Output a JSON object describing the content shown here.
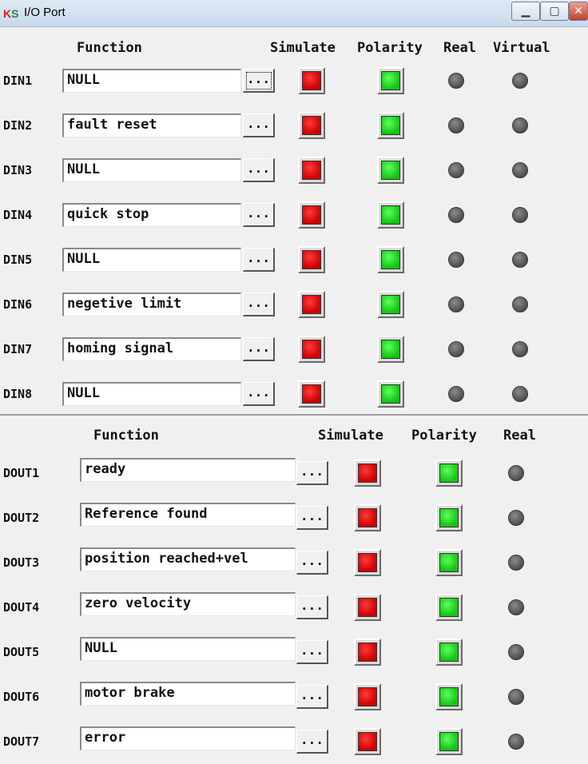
{
  "window": {
    "title": "I/O Port",
    "icon": "ks-app-icon",
    "icon_text_k": "K",
    "icon_text_s": "S",
    "min_glyph": "▁",
    "max_glyph": "▢",
    "close_glyph": "✕"
  },
  "din": {
    "headers": {
      "function": "Function",
      "simulate": "Simulate",
      "polarity": "Polarity",
      "real": "Real",
      "virtual": "Virtual"
    },
    "rows": [
      {
        "label": "DIN1",
        "function": "NULL",
        "button": "...",
        "simulate": "red",
        "polarity": "green",
        "real": "off",
        "virtual": "off"
      },
      {
        "label": "DIN2",
        "function": "fault reset",
        "button": "...",
        "simulate": "red",
        "polarity": "green",
        "real": "off",
        "virtual": "off"
      },
      {
        "label": "DIN3",
        "function": "NULL",
        "button": "...",
        "simulate": "red",
        "polarity": "green",
        "real": "off",
        "virtual": "off"
      },
      {
        "label": "DIN4",
        "function": "quick stop",
        "button": "...",
        "simulate": "red",
        "polarity": "green",
        "real": "off",
        "virtual": "off"
      },
      {
        "label": "DIN5",
        "function": "NULL",
        "button": "...",
        "simulate": "red",
        "polarity": "green",
        "real": "off",
        "virtual": "off"
      },
      {
        "label": "DIN6",
        "function": "negetive limit",
        "button": "...",
        "simulate": "red",
        "polarity": "green",
        "real": "off",
        "virtual": "off"
      },
      {
        "label": "DIN7",
        "function": "homing signal",
        "button": "...",
        "simulate": "red",
        "polarity": "green",
        "real": "off",
        "virtual": "off"
      },
      {
        "label": "DIN8",
        "function": "NULL",
        "button": "...",
        "simulate": "red",
        "polarity": "green",
        "real": "off",
        "virtual": "off"
      }
    ]
  },
  "dout": {
    "headers": {
      "function": "Function",
      "simulate": "Simulate",
      "polarity": "Polarity",
      "real": "Real"
    },
    "rows": [
      {
        "label": "DOUT1",
        "function": "ready",
        "button": "...",
        "simulate": "red",
        "polarity": "green",
        "real": "off"
      },
      {
        "label": "DOUT2",
        "function": "Reference found",
        "button": "...",
        "simulate": "red",
        "polarity": "green",
        "real": "off"
      },
      {
        "label": "DOUT3",
        "function": "position reached+vel",
        "button": "...",
        "simulate": "red",
        "polarity": "green",
        "real": "off"
      },
      {
        "label": "DOUT4",
        "function": "zero velocity",
        "button": "...",
        "simulate": "red",
        "polarity": "green",
        "real": "off"
      },
      {
        "label": "DOUT5",
        "function": "NULL",
        "button": "...",
        "simulate": "red",
        "polarity": "green",
        "real": "off"
      },
      {
        "label": "DOUT6",
        "function": "motor brake",
        "button": "...",
        "simulate": "red",
        "polarity": "green",
        "real": "off"
      },
      {
        "label": "DOUT7",
        "function": "error",
        "button": "...",
        "simulate": "red",
        "polarity": "green",
        "real": "off"
      }
    ]
  },
  "colors": {
    "simulate_on": "#e00000",
    "polarity_on": "#1fd11f",
    "led_off": "#5a5a5a"
  }
}
